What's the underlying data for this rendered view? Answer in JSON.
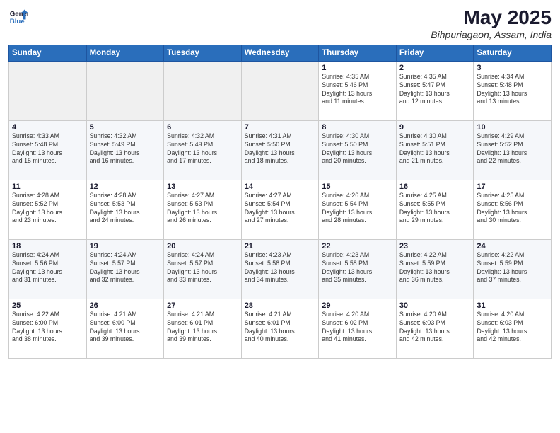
{
  "header": {
    "logo_line1": "General",
    "logo_line2": "Blue",
    "month": "May 2025",
    "location": "Bihpuriagaon, Assam, India"
  },
  "days_of_week": [
    "Sunday",
    "Monday",
    "Tuesday",
    "Wednesday",
    "Thursday",
    "Friday",
    "Saturday"
  ],
  "weeks": [
    [
      {
        "day": "",
        "detail": ""
      },
      {
        "day": "",
        "detail": ""
      },
      {
        "day": "",
        "detail": ""
      },
      {
        "day": "",
        "detail": ""
      },
      {
        "day": "1",
        "detail": "Sunrise: 4:35 AM\nSunset: 5:46 PM\nDaylight: 13 hours\nand 11 minutes."
      },
      {
        "day": "2",
        "detail": "Sunrise: 4:35 AM\nSunset: 5:47 PM\nDaylight: 13 hours\nand 12 minutes."
      },
      {
        "day": "3",
        "detail": "Sunrise: 4:34 AM\nSunset: 5:48 PM\nDaylight: 13 hours\nand 13 minutes."
      }
    ],
    [
      {
        "day": "4",
        "detail": "Sunrise: 4:33 AM\nSunset: 5:48 PM\nDaylight: 13 hours\nand 15 minutes."
      },
      {
        "day": "5",
        "detail": "Sunrise: 4:32 AM\nSunset: 5:49 PM\nDaylight: 13 hours\nand 16 minutes."
      },
      {
        "day": "6",
        "detail": "Sunrise: 4:32 AM\nSunset: 5:49 PM\nDaylight: 13 hours\nand 17 minutes."
      },
      {
        "day": "7",
        "detail": "Sunrise: 4:31 AM\nSunset: 5:50 PM\nDaylight: 13 hours\nand 18 minutes."
      },
      {
        "day": "8",
        "detail": "Sunrise: 4:30 AM\nSunset: 5:50 PM\nDaylight: 13 hours\nand 20 minutes."
      },
      {
        "day": "9",
        "detail": "Sunrise: 4:30 AM\nSunset: 5:51 PM\nDaylight: 13 hours\nand 21 minutes."
      },
      {
        "day": "10",
        "detail": "Sunrise: 4:29 AM\nSunset: 5:52 PM\nDaylight: 13 hours\nand 22 minutes."
      }
    ],
    [
      {
        "day": "11",
        "detail": "Sunrise: 4:28 AM\nSunset: 5:52 PM\nDaylight: 13 hours\nand 23 minutes."
      },
      {
        "day": "12",
        "detail": "Sunrise: 4:28 AM\nSunset: 5:53 PM\nDaylight: 13 hours\nand 24 minutes."
      },
      {
        "day": "13",
        "detail": "Sunrise: 4:27 AM\nSunset: 5:53 PM\nDaylight: 13 hours\nand 26 minutes."
      },
      {
        "day": "14",
        "detail": "Sunrise: 4:27 AM\nSunset: 5:54 PM\nDaylight: 13 hours\nand 27 minutes."
      },
      {
        "day": "15",
        "detail": "Sunrise: 4:26 AM\nSunset: 5:54 PM\nDaylight: 13 hours\nand 28 minutes."
      },
      {
        "day": "16",
        "detail": "Sunrise: 4:25 AM\nSunset: 5:55 PM\nDaylight: 13 hours\nand 29 minutes."
      },
      {
        "day": "17",
        "detail": "Sunrise: 4:25 AM\nSunset: 5:56 PM\nDaylight: 13 hours\nand 30 minutes."
      }
    ],
    [
      {
        "day": "18",
        "detail": "Sunrise: 4:24 AM\nSunset: 5:56 PM\nDaylight: 13 hours\nand 31 minutes."
      },
      {
        "day": "19",
        "detail": "Sunrise: 4:24 AM\nSunset: 5:57 PM\nDaylight: 13 hours\nand 32 minutes."
      },
      {
        "day": "20",
        "detail": "Sunrise: 4:24 AM\nSunset: 5:57 PM\nDaylight: 13 hours\nand 33 minutes."
      },
      {
        "day": "21",
        "detail": "Sunrise: 4:23 AM\nSunset: 5:58 PM\nDaylight: 13 hours\nand 34 minutes."
      },
      {
        "day": "22",
        "detail": "Sunrise: 4:23 AM\nSunset: 5:58 PM\nDaylight: 13 hours\nand 35 minutes."
      },
      {
        "day": "23",
        "detail": "Sunrise: 4:22 AM\nSunset: 5:59 PM\nDaylight: 13 hours\nand 36 minutes."
      },
      {
        "day": "24",
        "detail": "Sunrise: 4:22 AM\nSunset: 5:59 PM\nDaylight: 13 hours\nand 37 minutes."
      }
    ],
    [
      {
        "day": "25",
        "detail": "Sunrise: 4:22 AM\nSunset: 6:00 PM\nDaylight: 13 hours\nand 38 minutes."
      },
      {
        "day": "26",
        "detail": "Sunrise: 4:21 AM\nSunset: 6:00 PM\nDaylight: 13 hours\nand 39 minutes."
      },
      {
        "day": "27",
        "detail": "Sunrise: 4:21 AM\nSunset: 6:01 PM\nDaylight: 13 hours\nand 39 minutes."
      },
      {
        "day": "28",
        "detail": "Sunrise: 4:21 AM\nSunset: 6:01 PM\nDaylight: 13 hours\nand 40 minutes."
      },
      {
        "day": "29",
        "detail": "Sunrise: 4:20 AM\nSunset: 6:02 PM\nDaylight: 13 hours\nand 41 minutes."
      },
      {
        "day": "30",
        "detail": "Sunrise: 4:20 AM\nSunset: 6:03 PM\nDaylight: 13 hours\nand 42 minutes."
      },
      {
        "day": "31",
        "detail": "Sunrise: 4:20 AM\nSunset: 6:03 PM\nDaylight: 13 hours\nand 42 minutes."
      }
    ]
  ]
}
